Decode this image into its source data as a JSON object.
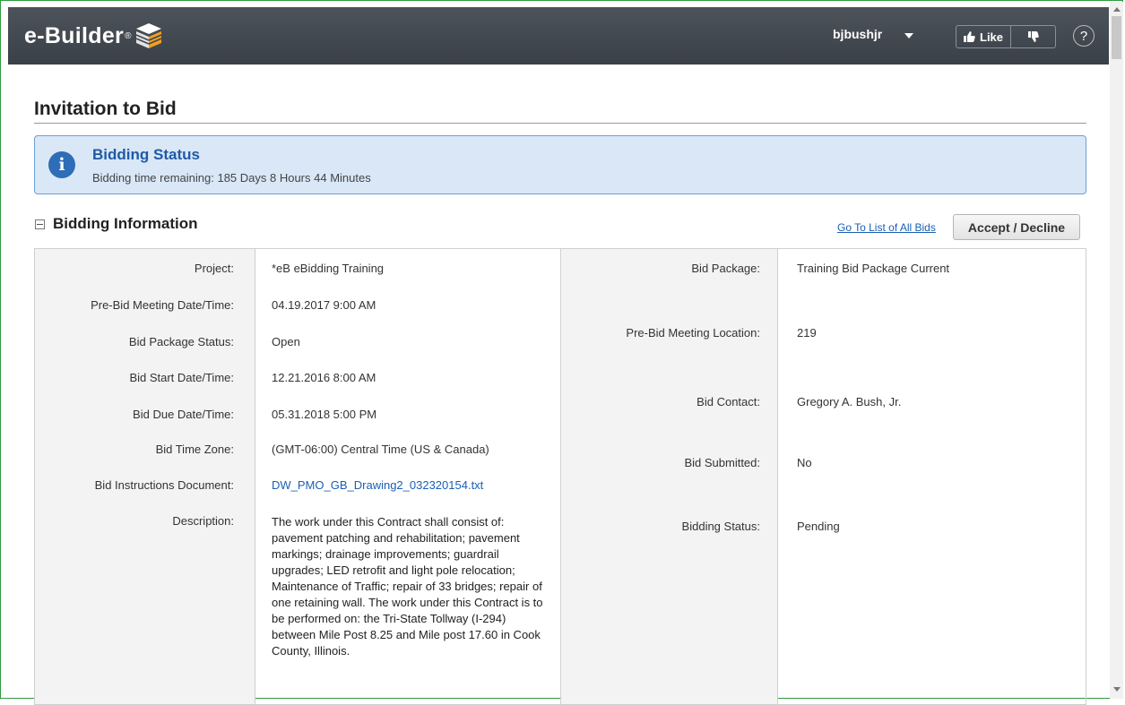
{
  "header": {
    "logo_text": "e-Builder",
    "logo_reg": "®",
    "username": "bjbushjr",
    "like_label": "Like",
    "help_label": "?"
  },
  "page": {
    "title": "Invitation to Bid"
  },
  "status": {
    "title": "Bidding Status",
    "text": "Bidding time remaining: 185 Days 8 Hours 44 Minutes"
  },
  "section": {
    "title": "Bidding Information",
    "list_link": "Go To List of All Bids",
    "accept_label": "Accept / Decline"
  },
  "left_fields": [
    {
      "label": "Project:",
      "value": "*eB eBidding Training"
    },
    {
      "label": "Pre-Bid Meeting Date/Time:",
      "value": "04.19.2017 9:00 AM"
    },
    {
      "label": "Bid Package Status:",
      "value": "Open"
    },
    {
      "label": "Bid Start Date/Time:",
      "value": "12.21.2016 8:00 AM"
    },
    {
      "label": "Bid Due Date/Time:",
      "value": "05.31.2018 5:00 PM"
    },
    {
      "label": "Bid Time Zone:",
      "value": "(GMT-06:00) Central Time (US & Canada)"
    },
    {
      "label": "Bid Instructions Document:",
      "value": "DW_PMO_GB_Drawing2_032320154.txt"
    },
    {
      "label": "Description:",
      "value": "The work under this Contract shall consist of: pavement patching and rehabilitation; pavement markings; drainage improvements; guardrail upgrades; LED retrofit and light pole relocation; Maintenance of Traffic; repair of 33 bridges; repair of one retaining wall. The work under this Contract is to be performed on: the Tri-State Tollway (I-294) between Mile Post 8.25 and Mile post 17.60 in Cook County, Illinois."
    }
  ],
  "right_fields": [
    {
      "label": "Bid Package:",
      "value": "Training Bid Package Current"
    },
    {
      "label": "Pre-Bid Meeting Location:",
      "value": "219"
    },
    {
      "label": "Bid Contact:",
      "value": "Gregory A. Bush, Jr."
    },
    {
      "label": "Bid Submitted:",
      "value": "No"
    },
    {
      "label": "Bidding Status:",
      "value": "Pending"
    }
  ],
  "colors": {
    "header_bg": "#41474e",
    "status_bg": "#d9e7f7",
    "status_border": "#6d9fd6",
    "link": "#1a5fb4",
    "frame_border": "#2e9a3e"
  }
}
